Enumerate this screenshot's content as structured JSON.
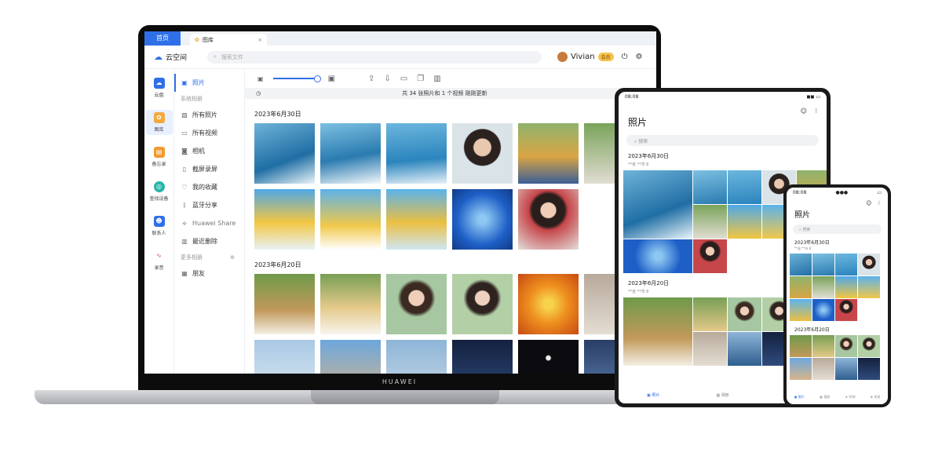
{
  "browser": {
    "tab_home": "首页",
    "tab_gallery": "图库",
    "tab_close": "×"
  },
  "app": {
    "brand": "云空间",
    "search_placeholder": "搜索文件",
    "user_name": "Vivian",
    "vip_badge": "会员"
  },
  "rail": [
    "云盘",
    "图库",
    "备忘录",
    "查找设备",
    "联系人",
    "录音"
  ],
  "nav": {
    "current": "照片",
    "system_head": "系统相册",
    "items": [
      "所有照片",
      "所有视频",
      "相机",
      "截屏录屏",
      "我的收藏",
      "蓝牙分享",
      "Huawei Share",
      "最近删除"
    ],
    "more_head": "更多相册",
    "more_items": [
      "朋友"
    ]
  },
  "main": {
    "info": "共 34 张照片和 1 个视频   刚刚更新",
    "date1": "2023年6月30日",
    "date2": "2023年6月20日"
  },
  "laptop_brand": "HUAWEI",
  "tablet": {
    "time": "08:08",
    "title": "照片",
    "search": "搜索",
    "date1": "2023年6月30日",
    "sub1": "**省 **市 8",
    "date2": "2023年6月20日",
    "sub2": "**省 **市 8",
    "nav": [
      "照片",
      "相册",
      "时刻"
    ]
  },
  "phone": {
    "time": "08:08",
    "title": "照片",
    "search": "搜索",
    "date1": "2023年6月30日",
    "sub1": "**省 **市 8",
    "date2": "2023年6月20日",
    "nav": [
      "照片",
      "相册",
      "时刻",
      "发现"
    ]
  },
  "colors": {
    "accent": "#2f6fe8"
  }
}
